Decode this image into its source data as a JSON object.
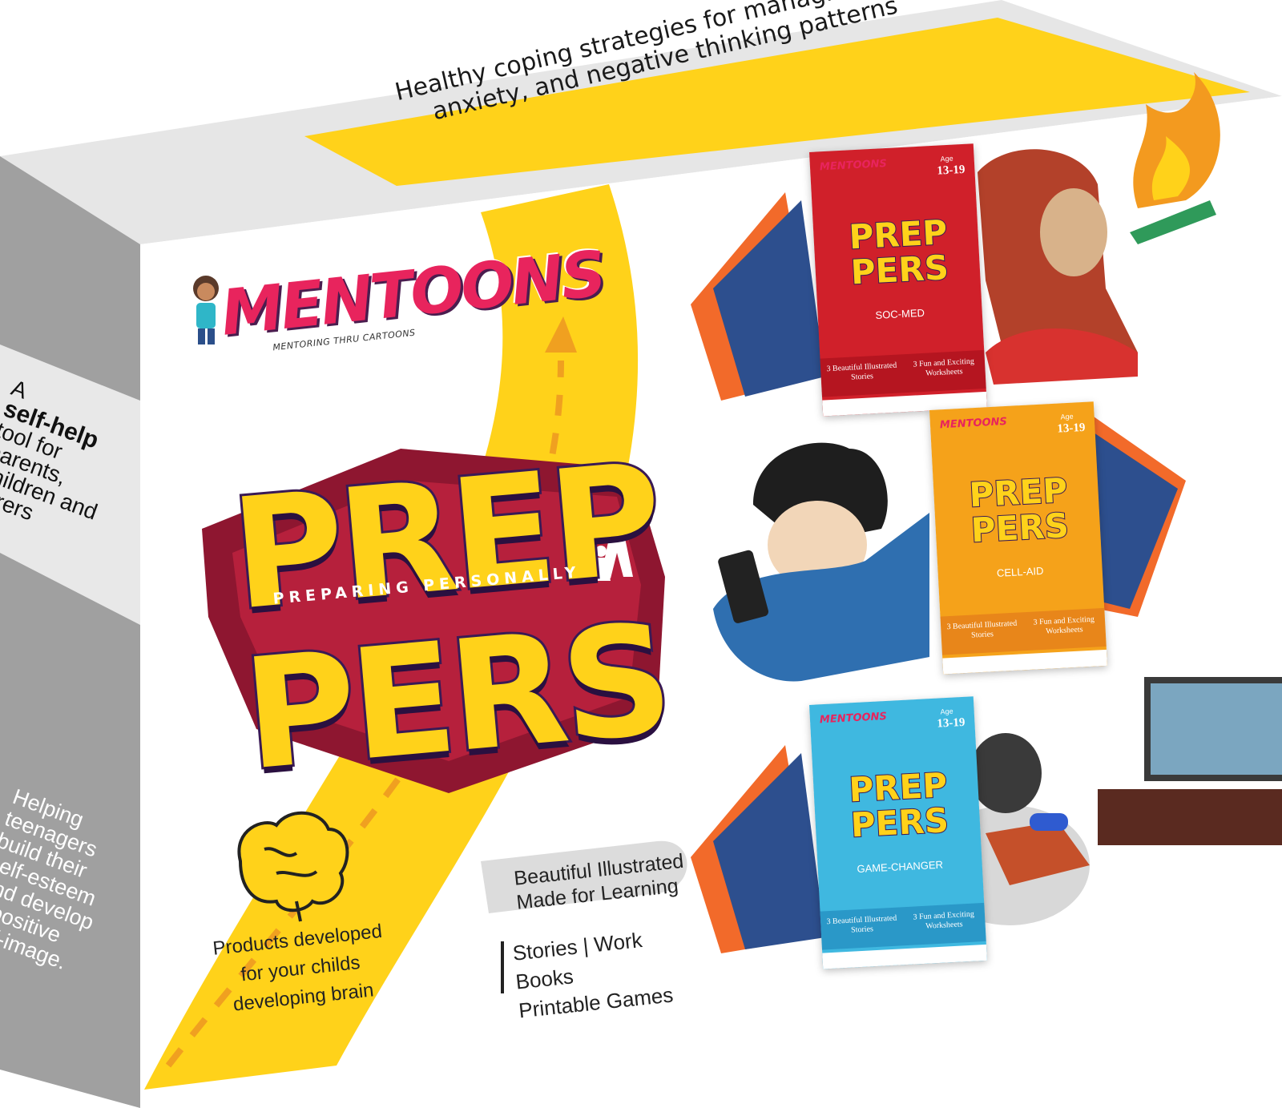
{
  "band": {
    "text_line1": "Healthy coping strategies for managing stress,",
    "text_line2": "anxiety, and negative thinking patterns"
  },
  "side_panel": {
    "top_a": "A",
    "top_bold": "self-help",
    "top_rest": "tool for parents, children and carers",
    "bottom": "Helping teenagers build their self-esteem and develop a positive self-image."
  },
  "logo": {
    "brand": "MENTOONS",
    "tagline": "MENTORING THRU CARTOONS"
  },
  "title": {
    "line1": "PREP",
    "line2": "PERS",
    "subtitle": "PREPARING PERSONALLY"
  },
  "bottom": {
    "products_text": "Products developed for your childs developing brain",
    "illustrated_line1": "Beautiful Illustrated",
    "illustrated_line2": "Made for Learning",
    "stories_line1": "Stories | Work Books",
    "stories_line2": "Printable Games"
  },
  "books": [
    {
      "brand": "MENTOONS",
      "age_label": "Age",
      "age": "13-19",
      "title_line1": "PREP",
      "title_line2": "PERS",
      "name": "SOC-MED",
      "foot_left": "3 Beautiful Illustrated Stories",
      "foot_right": "3 Fun and Exciting Worksheets",
      "color": "#d0202a"
    },
    {
      "brand": "MENTOONS",
      "age_label": "Age",
      "age": "13-19",
      "title_line1": "PREP",
      "title_line2": "PERS",
      "name": "CELL-AID",
      "foot_left": "3 Beautiful Illustrated Stories",
      "foot_right": "3 Fun and Exciting Worksheets",
      "color": "#f5a21a"
    },
    {
      "brand": "MENTOONS",
      "age_label": "Age",
      "age": "13-19",
      "title_line1": "PREP",
      "title_line2": "PERS",
      "name": "GAME-CHANGER",
      "foot_left": "3 Beautiful Illustrated Stories",
      "foot_right": "3 Fun and Exciting Worksheets",
      "color": "#3fb8e0"
    }
  ],
  "colors": {
    "accent_yellow": "#ffd21a",
    "brand_pink": "#e8245d",
    "shield_red": "#8e1630",
    "side_gray": "#9a9a9a"
  }
}
